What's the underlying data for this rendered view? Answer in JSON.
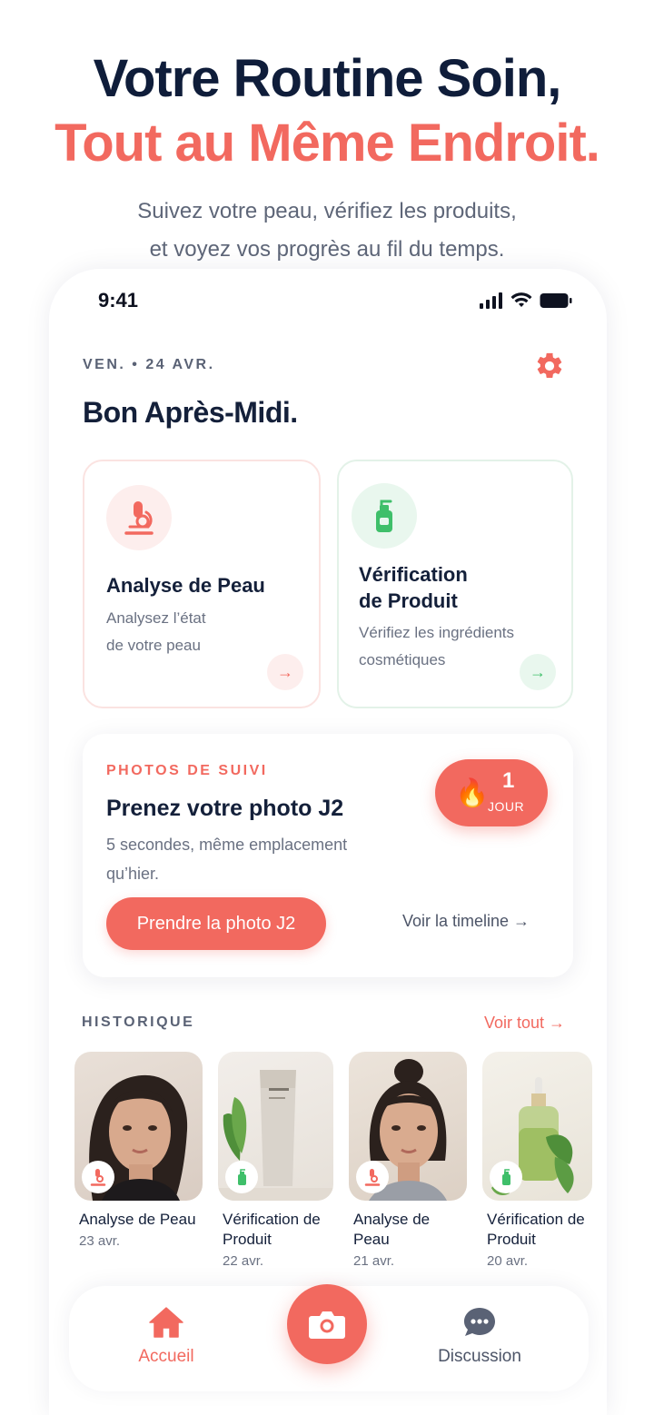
{
  "hero": {
    "line1": "Votre Routine Soin,",
    "line2": "Tout au Même Endroit.",
    "sub1": "Suivez votre peau, vérifiez les produits,",
    "sub2": "et voyez vos progrès au fil du temps."
  },
  "status": {
    "time": "9:41"
  },
  "header": {
    "date": "VEN. • 24 AVR.",
    "greeting": "Bon Après-Midi."
  },
  "cards": {
    "skin": {
      "title": "Analyse de Peau",
      "desc1": "Analysez l’état",
      "desc2": "de votre peau",
      "arrow": "→"
    },
    "product": {
      "title1": "Vérification",
      "title2": "de Produit",
      "desc1": "Vérifiez les ingrédients",
      "desc2": "cosmétiques",
      "arrow": "→"
    }
  },
  "followup": {
    "label": "PHOTOS DE SUIVI",
    "title": "Prenez votre photo J2",
    "desc1": "5 secondes, même emplacement",
    "desc2": "qu’hier.",
    "streak_fire": "🔥",
    "streak_count": "1",
    "streak_unit": "JOUR",
    "button": "Prendre la photo J2",
    "link": "Voir la timeline →"
  },
  "history": {
    "label": "HISTORIQUE",
    "see_all": "Voir tout →",
    "items": [
      {
        "title": "Analyse de Peau",
        "date": "23 avr."
      },
      {
        "title": "Vérification de Produit",
        "date": "22 avr."
      },
      {
        "title": "Analyse de Peau",
        "date": "21 avr."
      },
      {
        "title": "Vérification de Produit",
        "date": "20 avr."
      }
    ]
  },
  "nav": {
    "home": "Accueil",
    "chat": "Discussion"
  },
  "colors": {
    "accent": "#f2695f",
    "green": "#3fbf6a",
    "navy": "#14203a"
  }
}
